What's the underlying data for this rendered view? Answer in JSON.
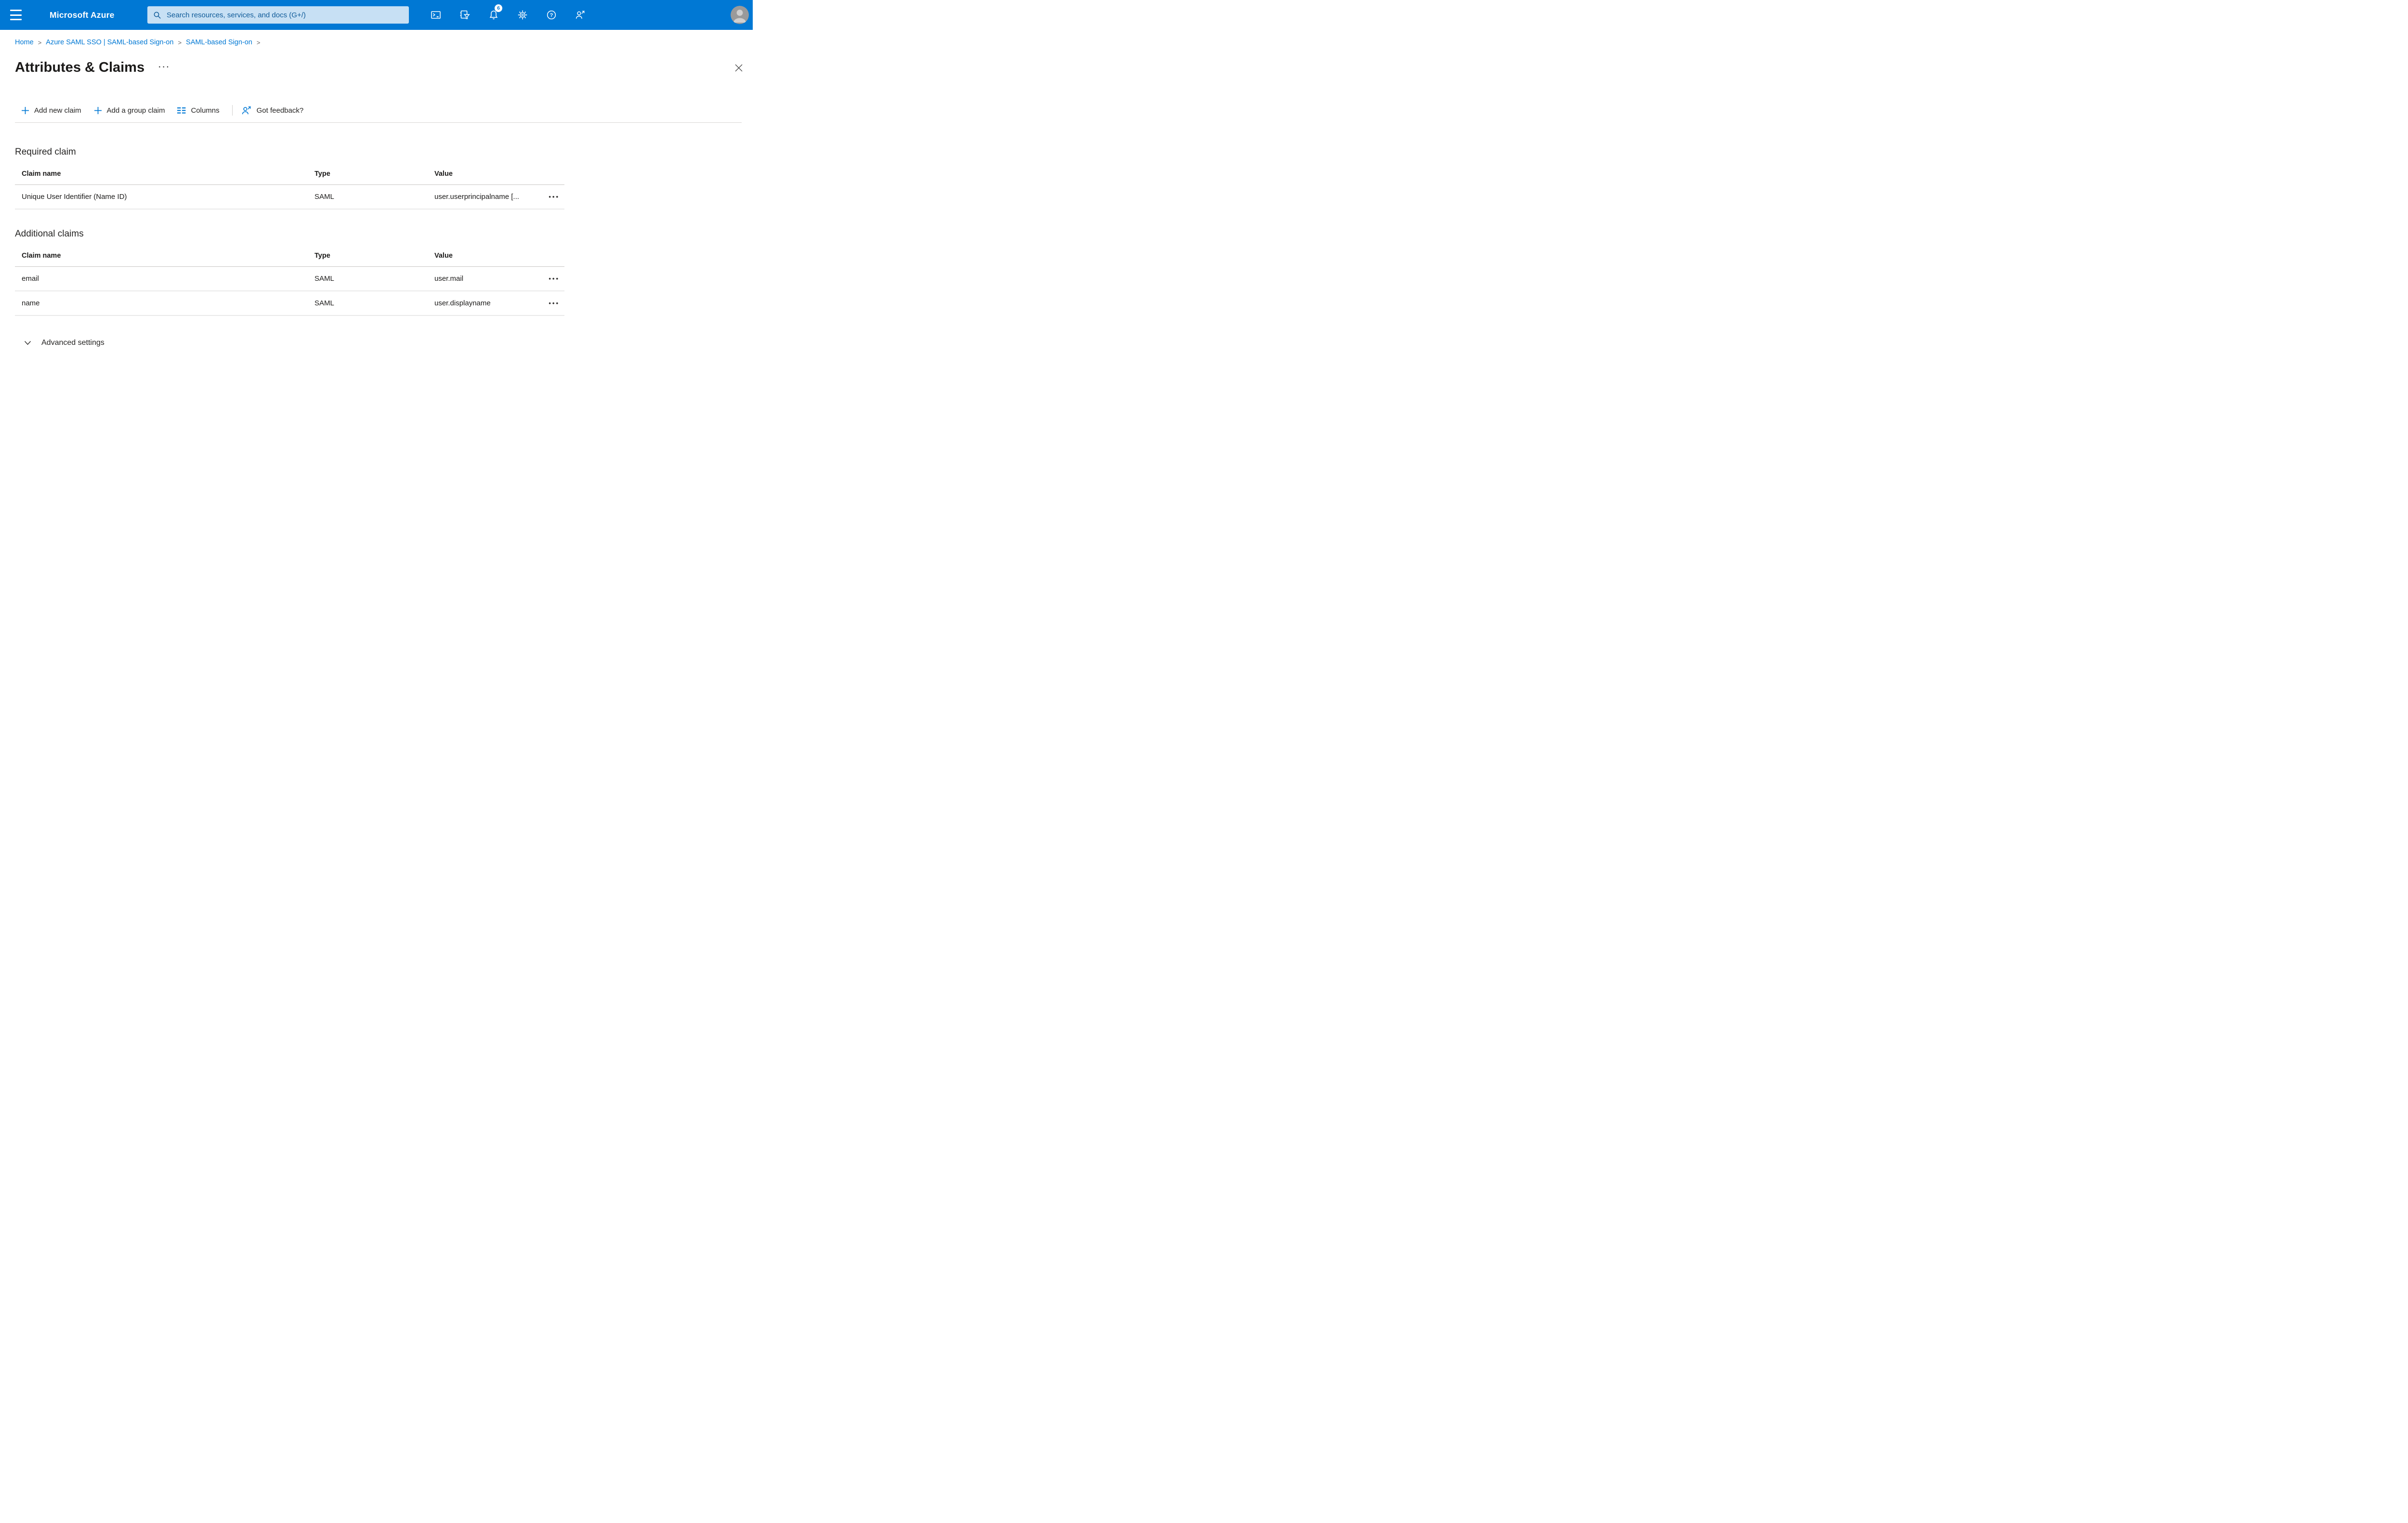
{
  "colors": {
    "topbar": "#0078d4",
    "accent": "#0078d4",
    "link": "#0078d4",
    "search_bg": "#c7e0f4",
    "search_fg": "#0f5b99",
    "text": "#323130",
    "muted": "#605e5c",
    "border": "#d8d6d4",
    "row_border": "#eaeaea",
    "header_border": "#c8c6c4"
  },
  "topbar": {
    "brand": "Microsoft Azure",
    "search_placeholder": "Search resources, services, and docs (G+/)",
    "notification_count": "6"
  },
  "breadcrumb": {
    "separator": ">",
    "items": [
      "Home",
      "Azure SAML SSO | SAML-based Sign-on",
      "SAML-based Sign-on"
    ]
  },
  "page": {
    "title": "Attributes & Claims"
  },
  "ui": {
    "title_ellipsis": "···",
    "row_ellipsis": "•••"
  },
  "toolbar": {
    "add_new_claim": "Add new claim",
    "add_group_claim": "Add a group claim",
    "columns": "Columns",
    "got_feedback": "Got feedback?"
  },
  "required_claim": {
    "heading": "Required claim",
    "columns": [
      "Claim name",
      "Type",
      "Value"
    ],
    "rows": [
      {
        "name": "Unique User Identifier (Name ID)",
        "type": "SAML",
        "value": "user.userprincipalname [..."
      }
    ]
  },
  "additional_claims": {
    "heading": "Additional claims",
    "columns": [
      "Claim name",
      "Type",
      "Value"
    ],
    "rows": [
      {
        "name": "email",
        "type": "SAML",
        "value": "user.mail"
      },
      {
        "name": "name",
        "type": "SAML",
        "value": "user.displayname"
      }
    ]
  },
  "advanced": {
    "label": "Advanced settings"
  }
}
